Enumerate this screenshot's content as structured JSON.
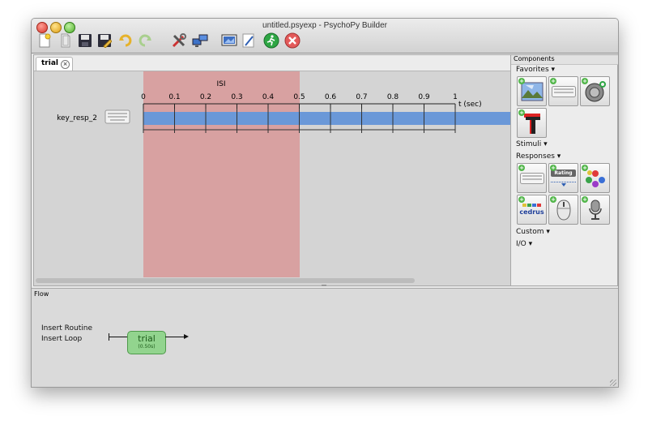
{
  "window": {
    "title": "untitled.psyexp - PsychoPy Builder"
  },
  "toolbar": {
    "buttons": [
      {
        "name": "new-file",
        "icon": "new-document-icon"
      },
      {
        "name": "open",
        "icon": "open-icon"
      },
      {
        "name": "save",
        "icon": "save-icon"
      },
      {
        "name": "save-as",
        "icon": "save-as-icon"
      },
      {
        "name": "undo",
        "icon": "undo-icon"
      },
      {
        "name": "redo",
        "icon": "redo-icon"
      },
      {
        "name": "preferences",
        "icon": "tools-icon"
      },
      {
        "name": "monitor-center",
        "icon": "monitor-icon"
      },
      {
        "name": "experiment-settings",
        "icon": "settings-screen-icon"
      },
      {
        "name": "compile-script",
        "icon": "compile-icon"
      },
      {
        "name": "run",
        "icon": "run-icon"
      },
      {
        "name": "stop",
        "icon": "stop-icon"
      }
    ]
  },
  "routine_editor": {
    "tab": {
      "label": "trial"
    },
    "isi_label": "ISI",
    "isi_range_sec": [
      0,
      0.5
    ],
    "time_axis": {
      "ticks": [
        "0",
        "0.1",
        "0.2",
        "0.3",
        "0.4",
        "0.5",
        "0.6",
        "0.7",
        "0.8",
        "0.9",
        "1"
      ],
      "unit_label": "t (sec)"
    },
    "components": [
      {
        "name": "key_resp_2",
        "icon": "keyboard-icon",
        "start": 0,
        "end": null
      }
    ]
  },
  "components_panel": {
    "header": "Components",
    "sections": {
      "favorites": "Favorites ▾",
      "stimuli": "Stimuli ▾",
      "responses": "Responses ▾",
      "custom": "Custom ▾",
      "io": "I/O ▾"
    },
    "favorites": [
      {
        "name": "image",
        "icon": "image-component-icon"
      },
      {
        "name": "keyboard",
        "icon": "keyboard-component-icon"
      },
      {
        "name": "sound",
        "icon": "sound-component-icon"
      },
      {
        "name": "text",
        "icon": "text-component-icon"
      }
    ],
    "responses": [
      {
        "name": "keyboard",
        "icon": "keyboard-component-icon"
      },
      {
        "name": "rating",
        "icon": "rating-component-icon",
        "text": "Rating"
      },
      {
        "name": "patch",
        "icon": "color-dots-icon"
      },
      {
        "name": "cedrus",
        "icon": "cedrus-component-icon",
        "text": "cedrus"
      },
      {
        "name": "mouse",
        "icon": "mouse-component-icon"
      },
      {
        "name": "microphone",
        "icon": "microphone-component-icon"
      }
    ]
  },
  "flow": {
    "label": "Flow",
    "insert_routine": "Insert Routine",
    "insert_loop": "Insert Loop",
    "routine": {
      "name": "trial",
      "duration": "(0.50s)"
    }
  }
}
